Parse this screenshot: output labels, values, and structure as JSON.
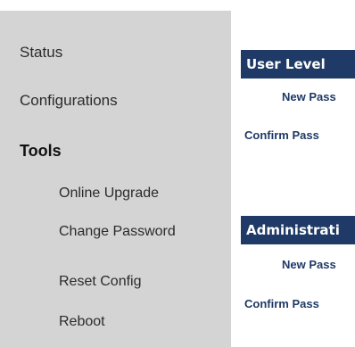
{
  "sidebar": {
    "items": [
      {
        "label": "Status"
      },
      {
        "label": "Configurations"
      },
      {
        "label": "Tools"
      },
      {
        "label": "Online Upgrade"
      },
      {
        "label": "Change Password"
      },
      {
        "label": "Reset Config"
      },
      {
        "label": "Reboot"
      }
    ]
  },
  "main": {
    "user_level": {
      "title": "User Level",
      "new_password_label": "New Pass",
      "confirm_password_label": "Confirm Pass"
    },
    "admin_level": {
      "title": "Administrati",
      "new_password_label": "New Pass",
      "confirm_password_label": "Confirm Pass"
    }
  },
  "colors": {
    "sidebar_bg": "#d4d4d4",
    "header_bg": "#1f3a66",
    "label_color": "#1f3a66"
  }
}
